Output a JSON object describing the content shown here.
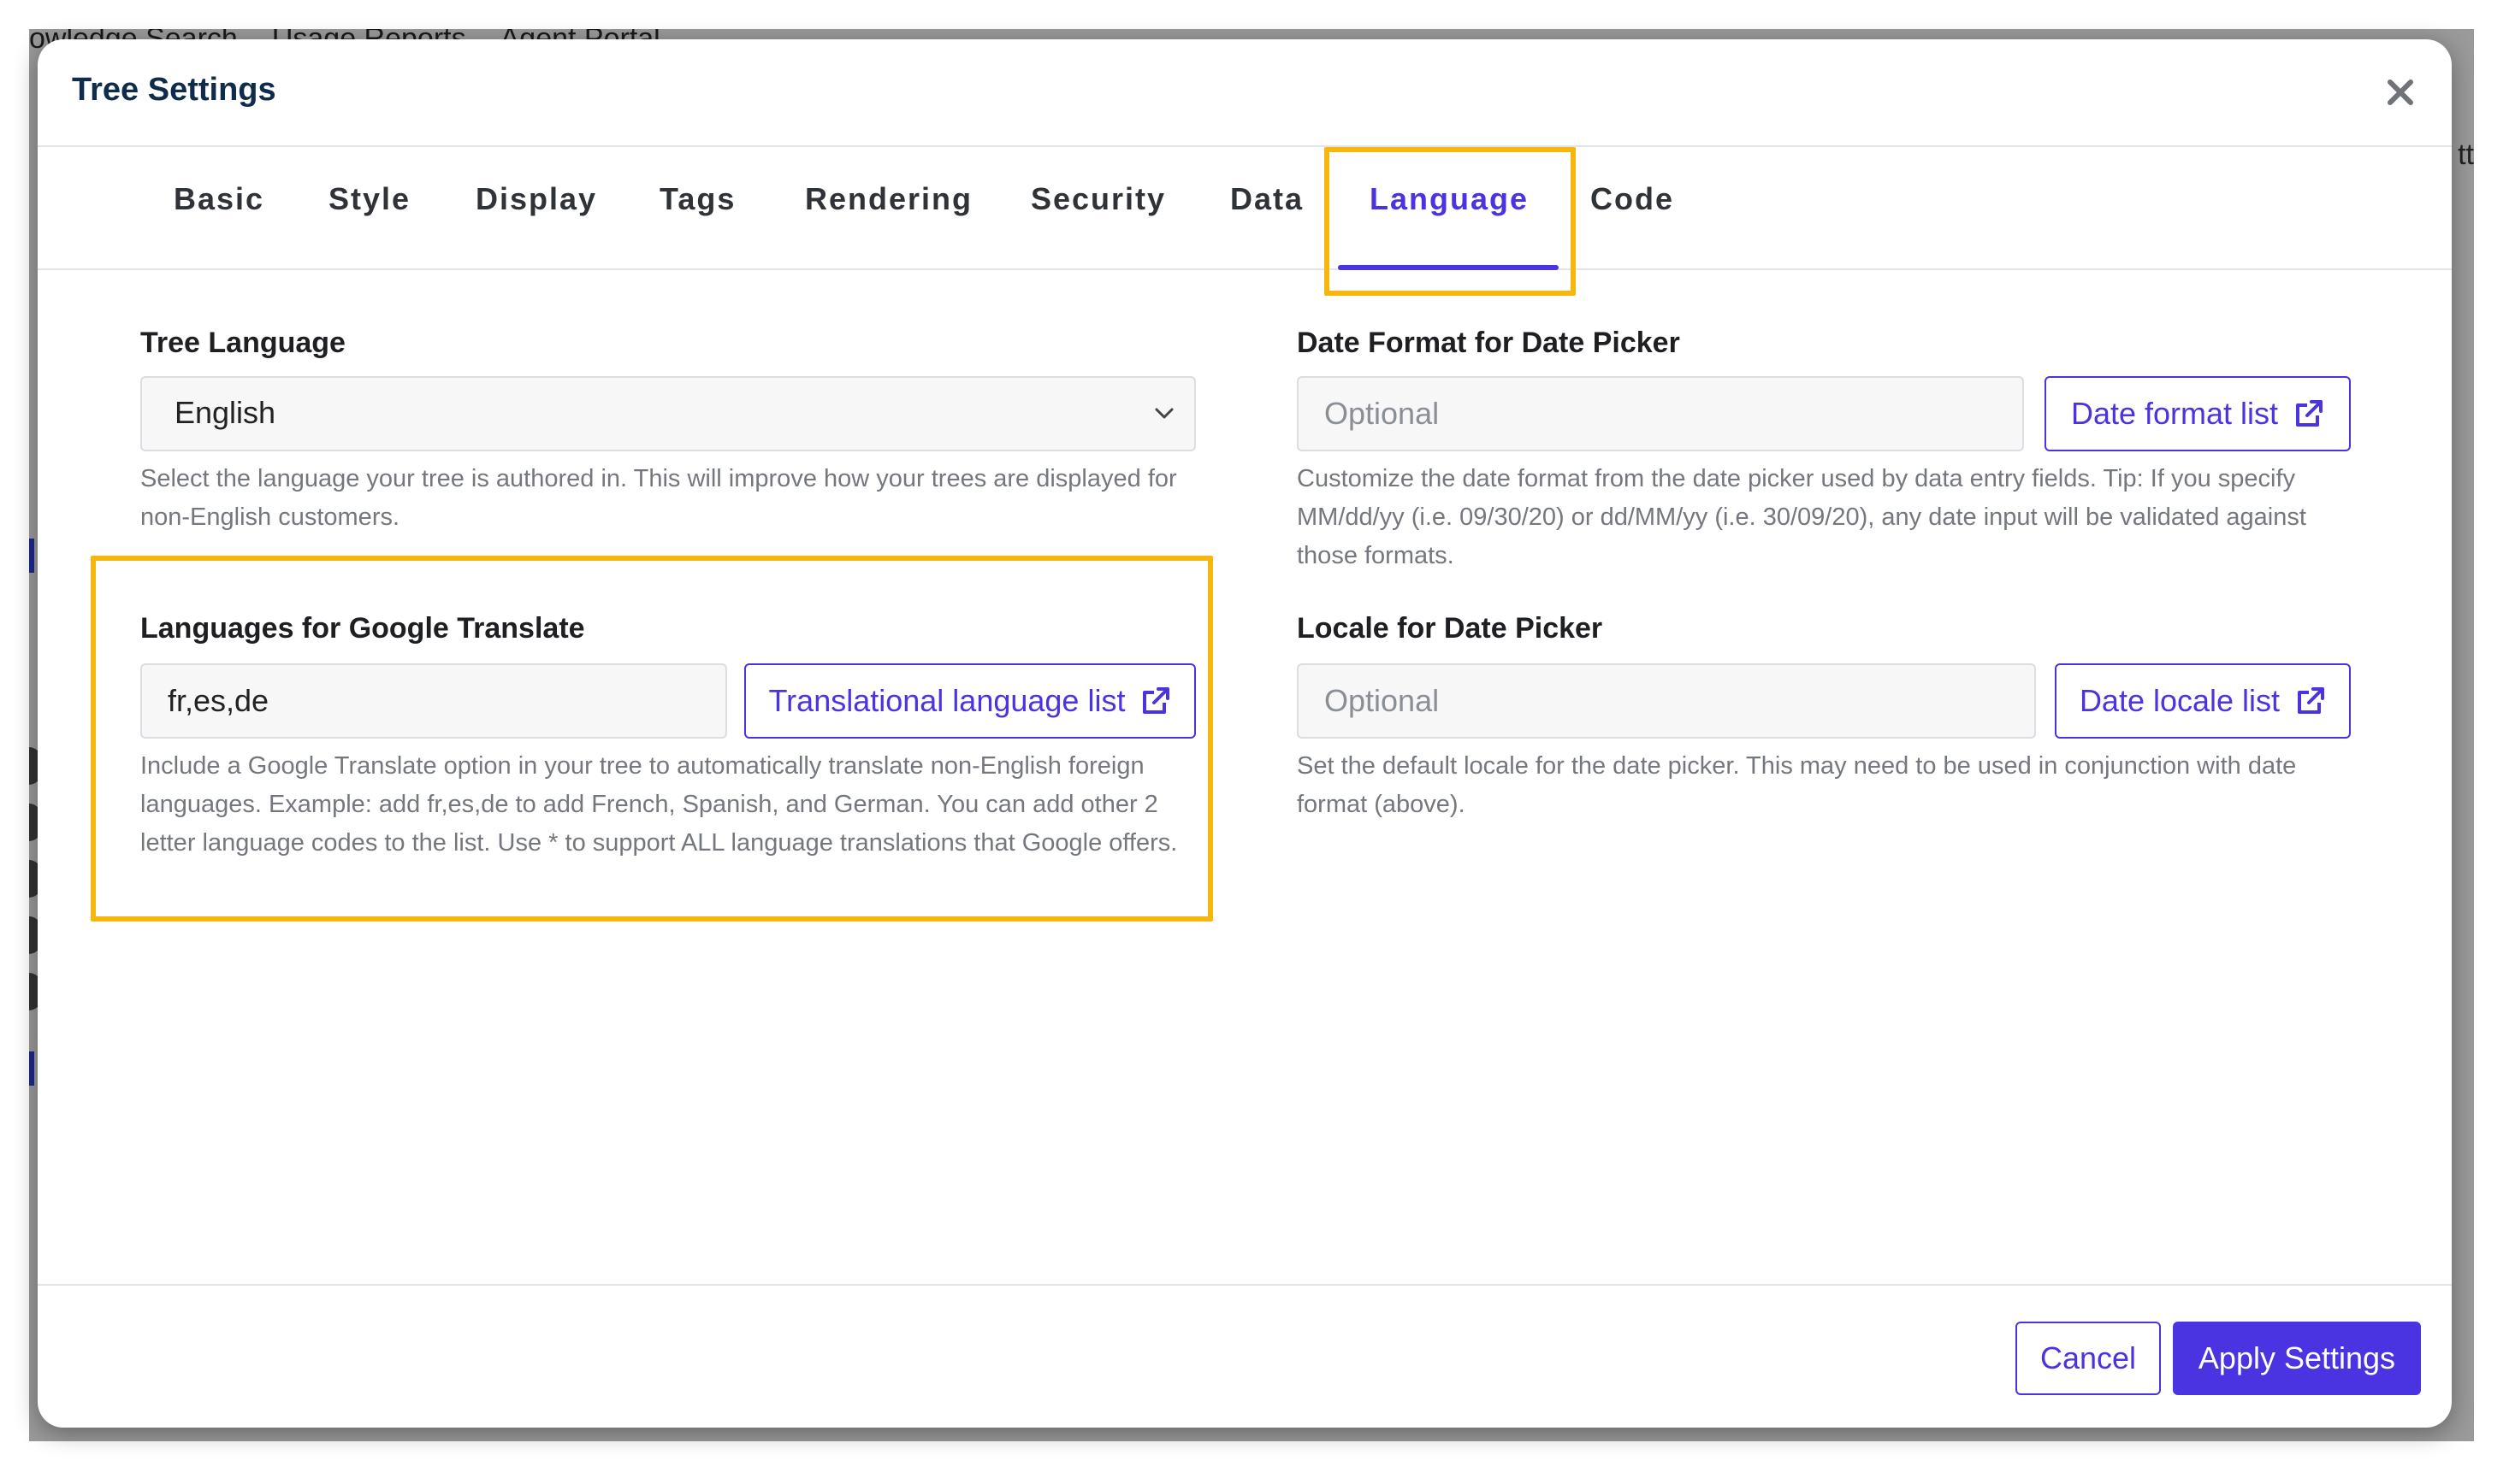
{
  "backdrop": {
    "nav": [
      "owledge Search",
      "Usage Reports",
      "Agent Portal"
    ],
    "right_text": "tt"
  },
  "modal": {
    "title": "Tree Settings",
    "close_icon": "close-icon",
    "tabs": [
      {
        "label": "Basic"
      },
      {
        "label": "Style"
      },
      {
        "label": "Display"
      },
      {
        "label": "Tags"
      },
      {
        "label": "Rendering"
      },
      {
        "label": "Security"
      },
      {
        "label": "Data"
      },
      {
        "label": "Language"
      },
      {
        "label": "Code"
      }
    ],
    "active_tab": "Language"
  },
  "tree_language": {
    "label": "Tree Language",
    "selected": "English",
    "help": "Select the language your tree is authored in. This will improve how your trees are displayed for non-English customers."
  },
  "google_translate": {
    "label": "Languages for Google Translate",
    "value": "fr,es,de",
    "link_label": "Translational language list",
    "help": "Include a Google Translate option in your tree to automatically translate non-English foreign languages. Example: add fr,es,de to add French, Spanish, and German. You can add other 2 letter language codes to the list. Use * to support ALL language translations that Google offers."
  },
  "date_format": {
    "label": "Date Format for Date Picker",
    "placeholder": "Optional",
    "link_label": "Date format list",
    "help": "Customize the date format from the date picker used by data entry fields. Tip: If you specify MM/dd/yy (i.e. 09/30/20) or dd/MM/yy (i.e. 30/09/20), any date input will be validated against those formats."
  },
  "date_locale": {
    "label": "Locale for Date Picker",
    "placeholder": "Optional",
    "link_label": "Date locale list",
    "help": "Set the default locale for the date picker. This may need to be used in conjunction with date format (above)."
  },
  "footer": {
    "cancel_label": "Cancel",
    "apply_label": "Apply Settings"
  },
  "colors": {
    "accent": "#4a33e0",
    "highlight": "#f7b60e",
    "title": "#0f2c4c"
  }
}
